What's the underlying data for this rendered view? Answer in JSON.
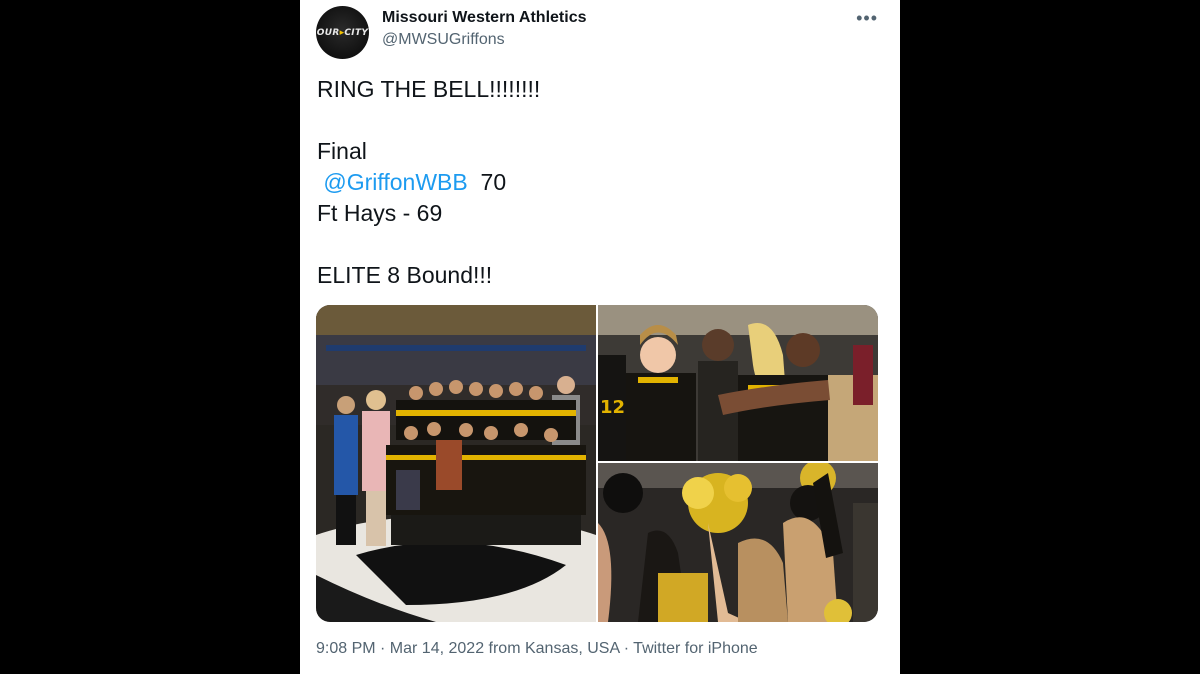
{
  "tweet": {
    "author_name": "Missouri Western Athletics",
    "handle": "@MWSUGriffons",
    "avatar_text_a": "OUR",
    "avatar_text_b": "CITY",
    "more": "•••",
    "line1": "RING THE BELL!!!!!!!!",
    "line2": "Final",
    "mention": "@GriffonWBB",
    "score1": "70",
    "line4": "Ft Hays - 69",
    "line5": "ELITE 8 Bound!!!",
    "meta": "9:08 PM · Mar 14, 2022 from Kansas, USA · Twitter for iPhone"
  },
  "media": [
    {
      "label": "team-celebration-photo"
    },
    {
      "label": "players-hugging-photo"
    },
    {
      "label": "cheer-celebration-photo"
    }
  ],
  "colors": {
    "link": "#1d9bf0",
    "secondary": "#536471",
    "primary": "#0f1419",
    "gold": "#f2c200"
  }
}
